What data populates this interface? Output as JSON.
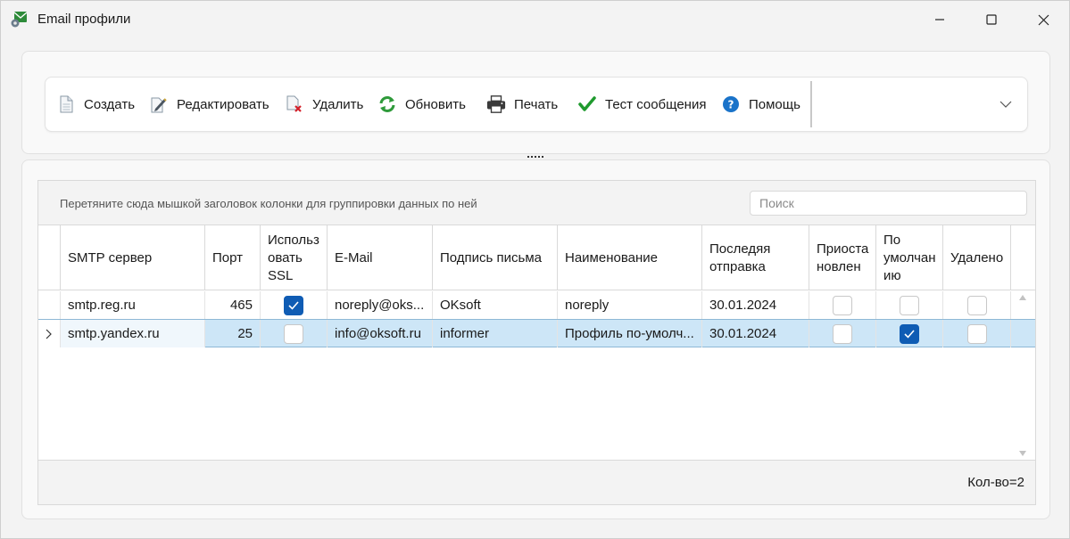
{
  "window": {
    "title": "Email профили",
    "app_icon": "email-settings-icon"
  },
  "toolbar": {
    "items": [
      {
        "label": "Создать",
        "icon": "new-document-icon"
      },
      {
        "label": "Редактировать",
        "icon": "edit-document-icon"
      },
      {
        "label": "Удалить",
        "icon": "delete-document-icon"
      },
      {
        "label": "Обновить",
        "icon": "refresh-icon"
      },
      {
        "label": "Печать",
        "icon": "printer-icon"
      },
      {
        "label": "Тест сообщения",
        "icon": "checkmark-icon"
      },
      {
        "label": "Помощь",
        "icon": "help-icon"
      }
    ]
  },
  "grid": {
    "group_hint": "Перетяните сюда мышкой заголовок колонки для группировки данных по ней",
    "search_placeholder": "Поиск",
    "columns": [
      {
        "label": "SMTP сервер"
      },
      {
        "label": "Порт"
      },
      {
        "label": "Использовать SSL",
        "lines": [
          "Использ",
          "овать",
          "SSL"
        ]
      },
      {
        "label": "E-Mail"
      },
      {
        "label": "Подпись письма"
      },
      {
        "label": "Наименование"
      },
      {
        "label": "Последяя отправка",
        "lines": [
          "Последяя",
          "отправка"
        ]
      },
      {
        "label": "Приостановлен",
        "lines": [
          "Приоста",
          "новлен"
        ]
      },
      {
        "label": "По умолчанию",
        "lines": [
          "По",
          "умолчан",
          "ию"
        ]
      },
      {
        "label": "Удалено"
      }
    ],
    "rows": [
      {
        "smtp": "smtp.reg.ru",
        "port": "465",
        "ssl": true,
        "email": "noreply@oks...",
        "signature": "OKsoft",
        "name": "noreply",
        "last_sent": "30.01.2024",
        "suspended": false,
        "is_default": false,
        "deleted": false,
        "selected": false
      },
      {
        "smtp": "smtp.yandex.ru",
        "port": "25",
        "ssl": false,
        "email": "info@oksoft.ru",
        "signature": "informer",
        "name": "Профиль по-умолч...",
        "last_sent": "30.01.2024",
        "suspended": false,
        "is_default": true,
        "deleted": false,
        "selected": true
      }
    ],
    "count_text": "Кол-во=2"
  },
  "colors": {
    "accent": "#0f5cb4",
    "selection": "#cde6f7",
    "refresh_green": "#2e9a3a",
    "check_green": "#1f9a2e",
    "help_blue": "#1a73c9"
  }
}
